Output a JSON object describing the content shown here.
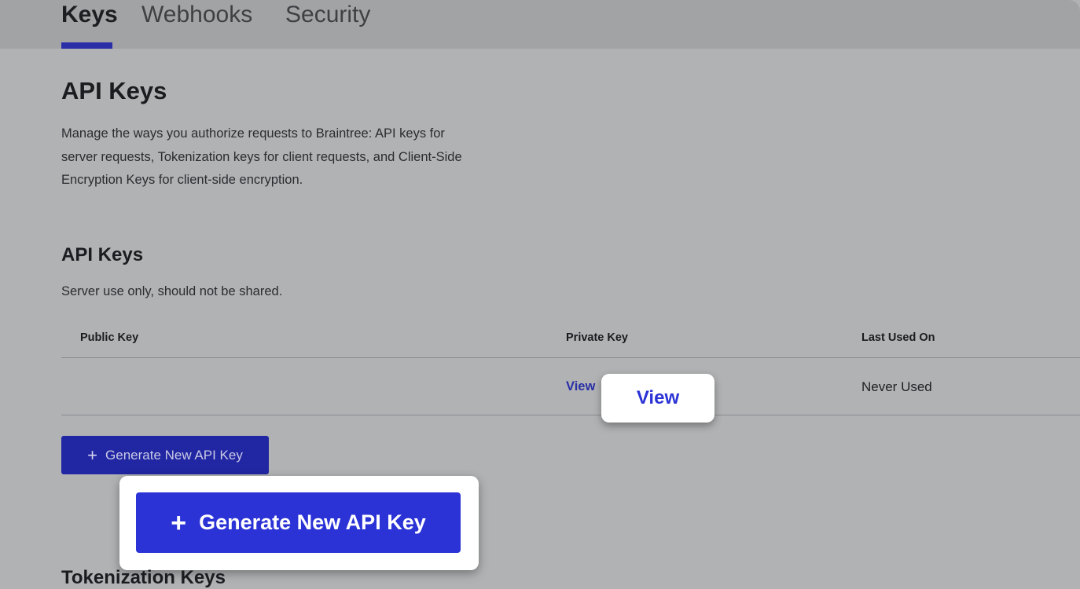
{
  "tabs": [
    {
      "label": "Keys",
      "active": true
    },
    {
      "label": "Webhooks",
      "active": false
    },
    {
      "label": "Security",
      "active": false
    }
  ],
  "page": {
    "title": "API Keys",
    "description_lines": [
      "Manage the ways you authorize requests to Braintree: API keys for",
      "server requests, Tokenization keys for client requests, and Client-Side",
      "Encryption Keys for client-side encryption."
    ]
  },
  "api_keys_section": {
    "title": "API Keys",
    "subtitle": "Server use only, should not be shared.",
    "columns": [
      "Public Key",
      "Private Key",
      "Last Used On"
    ],
    "rows": [
      {
        "public_key": "",
        "private_key_link": "View",
        "last_used": "Never Used"
      }
    ],
    "generate_button": {
      "icon": "plus-icon",
      "label": "Generate New API Key"
    }
  },
  "callouts": {
    "view_label": "View",
    "generate_label": "Generate New API Key",
    "generate_icon": "plus-icon"
  },
  "tokenization_section": {
    "title": "Tokenization Keys"
  },
  "colors": {
    "accent": "#2b33d6",
    "button_dark": "#2126a2",
    "tab_underline": "#2a2fa8"
  }
}
